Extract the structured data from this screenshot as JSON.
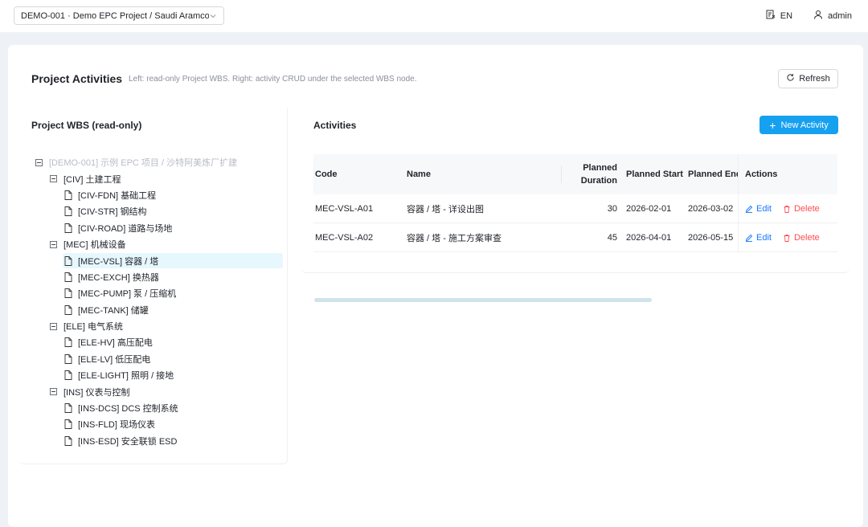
{
  "header": {
    "project_select": "DEMO-001 · Demo EPC Project / Saudi Aramco ...",
    "lang": "EN",
    "user": "admin"
  },
  "page": {
    "title": "Project Activities",
    "subtitle": "Left: read-only Project WBS. Right: activity CRUD under the selected WBS node.",
    "refresh_label": "Refresh"
  },
  "wbs": {
    "title": "Project WBS (read-only)",
    "root": "[DEMO-001] 示例 EPC 项目 / 沙特阿美炼厂扩建",
    "groups": [
      {
        "label": "[CIV] 土建工程",
        "items": [
          "[CIV-FDN] 基础工程",
          "[CIV-STR] 钢结构",
          "[CIV-ROAD] 道路与场地"
        ]
      },
      {
        "label": "[MEC] 机械设备",
        "items": [
          "[MEC-VSL] 容器 / 塔",
          "[MEC-EXCH] 换热器",
          "[MEC-PUMP] 泵 / 压缩机",
          "[MEC-TANK] 储罐"
        ]
      },
      {
        "label": "[ELE] 电气系统",
        "items": [
          "[ELE-HV] 高压配电",
          "[ELE-LV] 低压配电",
          "[ELE-LIGHT] 照明 / 接地"
        ]
      },
      {
        "label": "[INS] 仪表与控制",
        "items": [
          "[INS-DCS] DCS 控制系统",
          "[INS-FLD] 现场仪表",
          "[INS-ESD] 安全联锁 ESD"
        ]
      }
    ],
    "selected": "[MEC-VSL] 容器 / 塔"
  },
  "activities": {
    "title": "Activities",
    "new_label": "New Activity",
    "columns": {
      "code": "Code",
      "name": "Name",
      "duration_line1": "Planned",
      "duration_line2": "Duration",
      "start": "Planned Start",
      "end": "Planned End",
      "actions": "Actions"
    },
    "rows": [
      {
        "code": "MEC-VSL-A01",
        "name": "容器 / 塔 - 详设出图",
        "duration": "30",
        "start": "2026-02-01",
        "end": "2026-03-02"
      },
      {
        "code": "MEC-VSL-A02",
        "name": "容器 / 塔 - 施工方案审查",
        "duration": "45",
        "start": "2026-04-01",
        "end": "2026-05-15"
      }
    ],
    "edit_label": "Edit",
    "delete_label": "Delete"
  },
  "colors": {
    "primary": "#16a0f0",
    "link": "#1677ff",
    "danger": "#ff4d4f",
    "selected_bg": "#e6f7fd"
  }
}
